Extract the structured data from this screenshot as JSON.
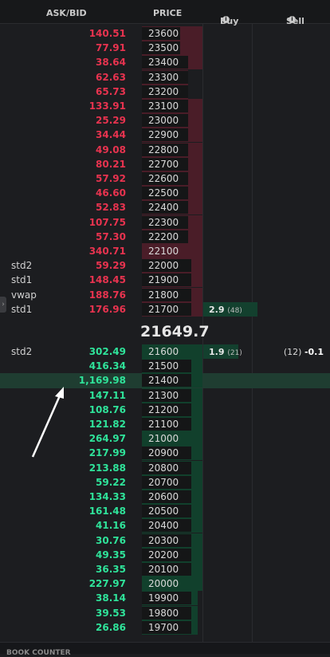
{
  "header": {
    "ask_bid": "ASK/BID",
    "price": "PRICE",
    "buy": "Buy",
    "sell": "Sell"
  },
  "mid_price": "21649.7",
  "footer_label": "BOOK COUNTER",
  "colors": {
    "ask": "#e8334f",
    "bid": "#2fe39a",
    "background": "#1c1d20"
  },
  "asks": [
    {
      "qty": "140.51",
      "price": "23600"
    },
    {
      "qty": "77.91",
      "price": "23500"
    },
    {
      "qty": "38.64",
      "price": "23400"
    },
    {
      "qty": "62.63",
      "price": "23300"
    },
    {
      "qty": "65.73",
      "price": "23200"
    },
    {
      "qty": "133.91",
      "price": "23100"
    },
    {
      "qty": "25.29",
      "price": "23000"
    },
    {
      "qty": "34.44",
      "price": "22900"
    },
    {
      "qty": "49.08",
      "price": "22800"
    },
    {
      "qty": "80.21",
      "price": "22700"
    },
    {
      "qty": "57.92",
      "price": "22600"
    },
    {
      "qty": "46.60",
      "price": "22500"
    },
    {
      "qty": "52.83",
      "price": "22400"
    },
    {
      "qty": "107.75",
      "price": "22300"
    },
    {
      "qty": "57.30",
      "price": "22200"
    },
    {
      "qty": "340.71",
      "price": "22100"
    },
    {
      "qty": "59.29",
      "price": "22000",
      "label": "std2"
    },
    {
      "qty": "148.45",
      "price": "21900",
      "label": "std1"
    },
    {
      "qty": "188.76",
      "price": "21800",
      "label": "vwap"
    },
    {
      "qty": "176.96",
      "price": "21700",
      "label": "std1",
      "buy": "2.9",
      "buy_count": "(48)"
    }
  ],
  "bids": [
    {
      "qty": "302.49",
      "price": "21600",
      "label": "std2",
      "buy": "1.9",
      "buy_count": "(21)",
      "sell_count": "(12)",
      "sell": "-0.1"
    },
    {
      "qty": "416.34",
      "price": "21500"
    },
    {
      "qty": "1,169.98",
      "price": "21400"
    },
    {
      "qty": "147.11",
      "price": "21300"
    },
    {
      "qty": "108.76",
      "price": "21200"
    },
    {
      "qty": "121.82",
      "price": "21100"
    },
    {
      "qty": "264.97",
      "price": "21000"
    },
    {
      "qty": "217.99",
      "price": "20900"
    },
    {
      "qty": "213.88",
      "price": "20800"
    },
    {
      "qty": "59.22",
      "price": "20700"
    },
    {
      "qty": "134.33",
      "price": "20600"
    },
    {
      "qty": "161.48",
      "price": "20500"
    },
    {
      "qty": "41.16",
      "price": "20400"
    },
    {
      "qty": "30.76",
      "price": "20300"
    },
    {
      "qty": "49.35",
      "price": "20200"
    },
    {
      "qty": "36.35",
      "price": "20100"
    },
    {
      "qty": "227.97",
      "price": "20000"
    },
    {
      "qty": "38.14",
      "price": "19900"
    },
    {
      "qty": "39.53",
      "price": "19800"
    },
    {
      "qty": "26.86",
      "price": "19700"
    }
  ]
}
